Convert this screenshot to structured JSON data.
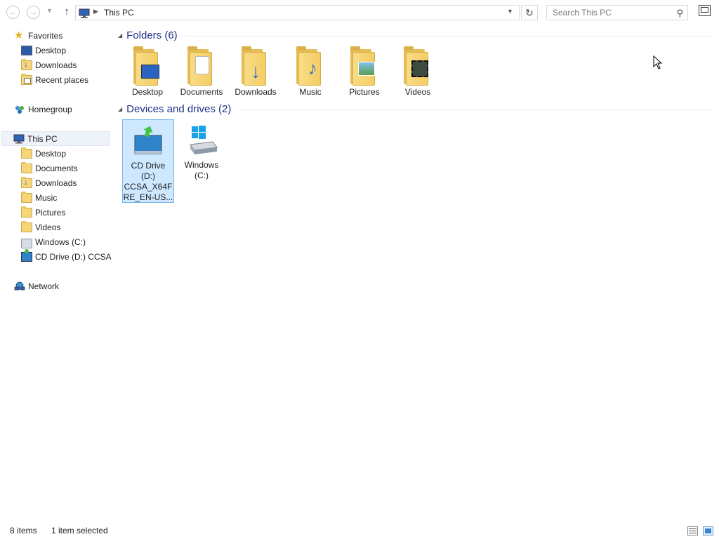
{
  "address": {
    "location": "This PC",
    "search_placeholder": "Search This PC"
  },
  "nav": {
    "favorites": "Favorites",
    "desktop": "Desktop",
    "downloads": "Downloads",
    "recent_places": "Recent places",
    "homegroup": "Homegroup",
    "this_pc": "This PC",
    "pc_items": [
      "Desktop",
      "Documents",
      "Downloads",
      "Music",
      "Pictures",
      "Videos",
      "Windows (C:)",
      "CD Drive (D:) CCSA_"
    ],
    "network": "Network"
  },
  "content": {
    "folders_header": "Folders (6)",
    "folders": [
      "Desktop",
      "Documents",
      "Downloads",
      "Music",
      "Pictures",
      "Videos"
    ],
    "drives_header": "Devices and drives (2)",
    "drives": [
      {
        "line1": "CD Drive",
        "line2": "(D:)",
        "line3": "CCSA_X64F",
        "line4": "RE_EN-US..."
      },
      {
        "line1": "Windows",
        "line2": "(C:)"
      }
    ]
  },
  "status": {
    "items": "8 items",
    "selected": "1 item selected"
  },
  "colors": {
    "group_title": "#1e3287",
    "selection": "#cde8ff",
    "selection_border": "#7ab4e6"
  }
}
